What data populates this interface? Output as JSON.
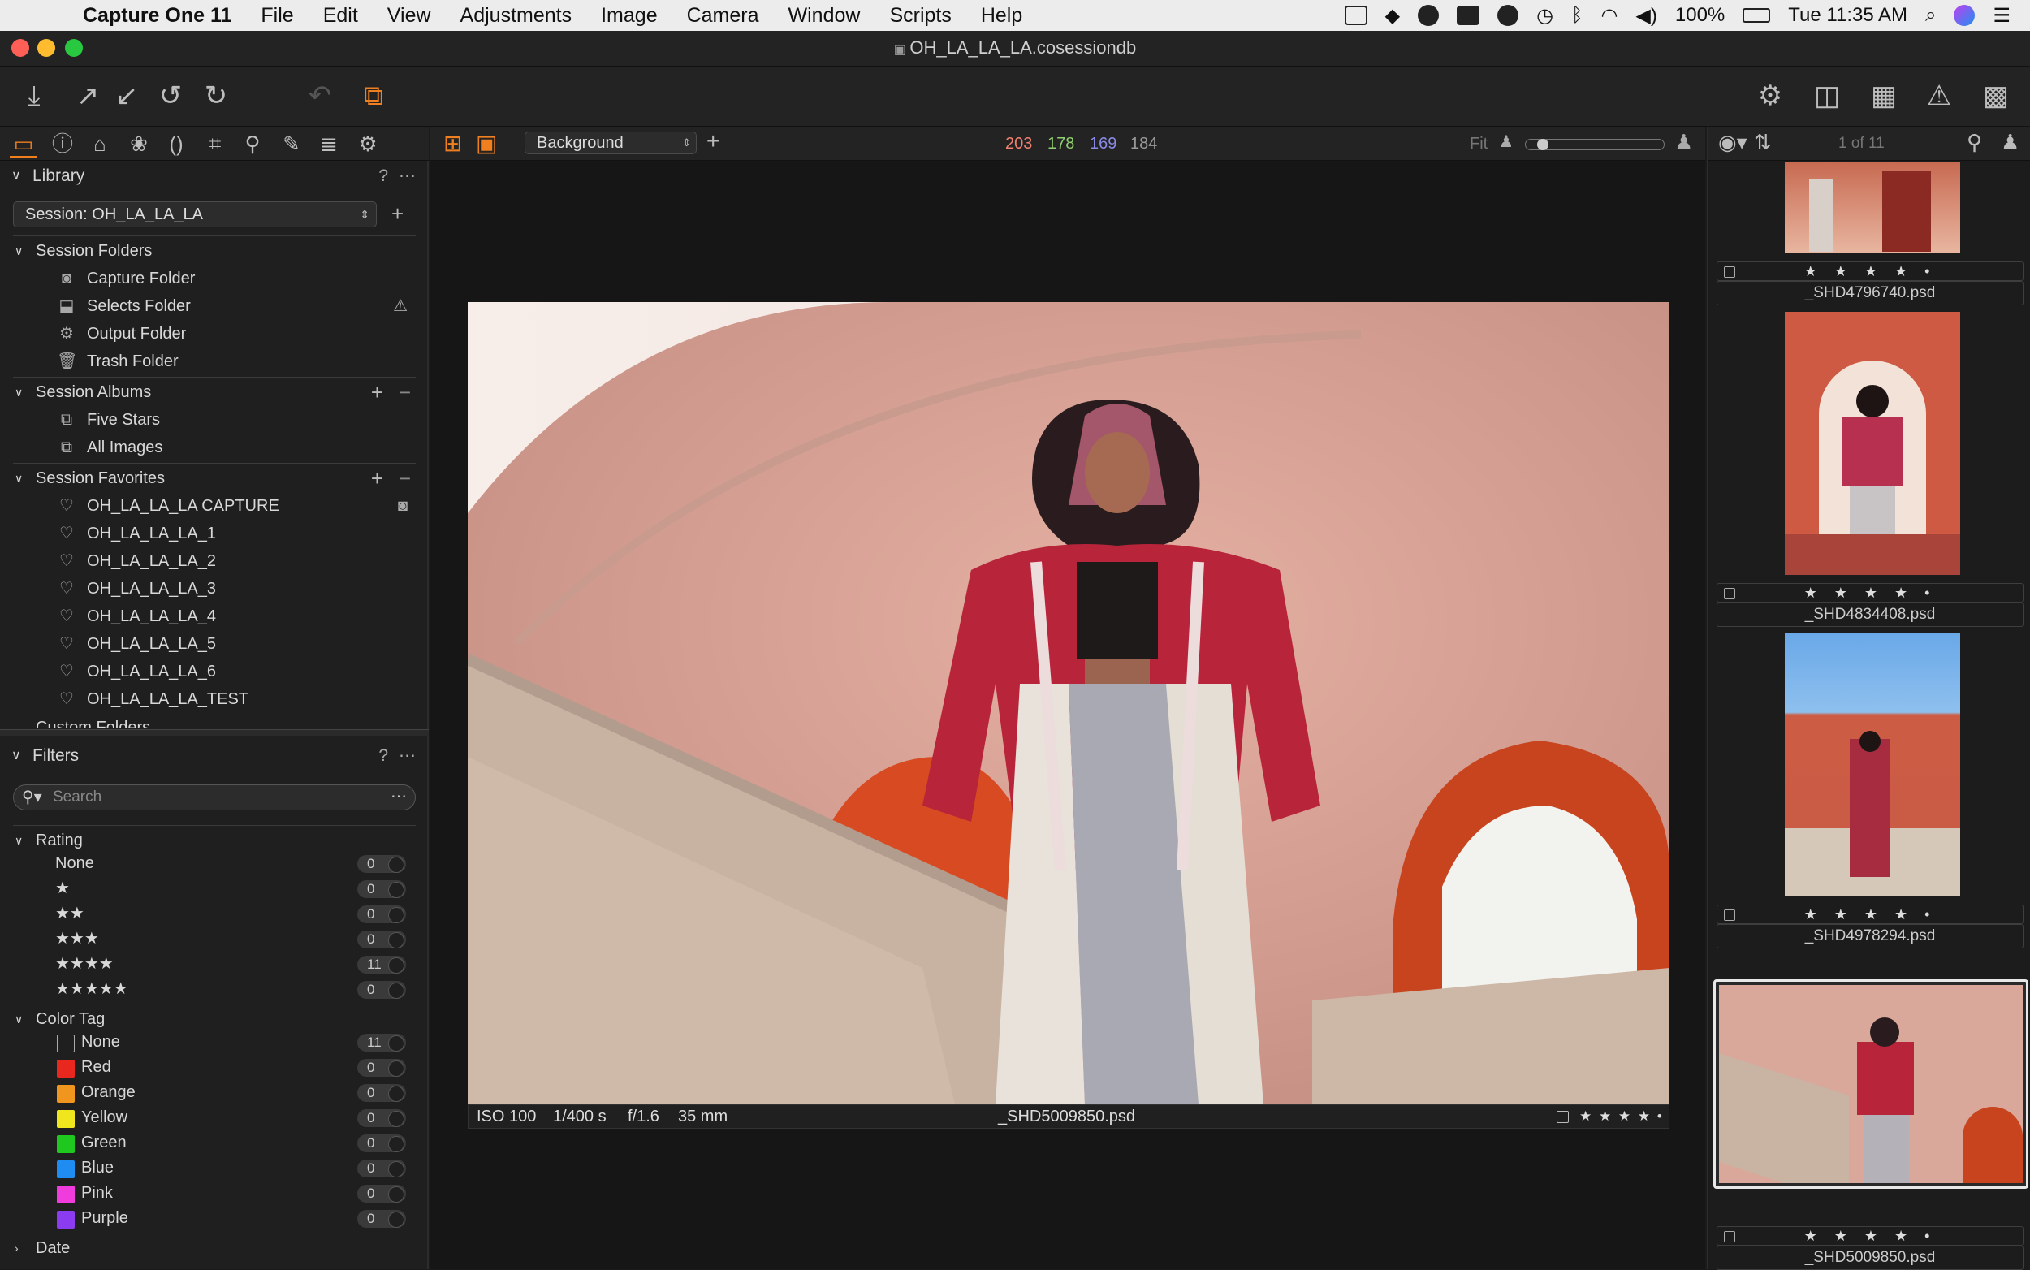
{
  "menubar": {
    "app": "Capture One 11",
    "items": [
      "File",
      "Edit",
      "View",
      "Adjustments",
      "Image",
      "Camera",
      "Window",
      "Scripts",
      "Help"
    ],
    "battery": "100%",
    "clock": "Tue 11:35 AM"
  },
  "window": {
    "title": "OH_LA_LA_LA.cosessiondb"
  },
  "viewer_bar": {
    "layer": "Background",
    "readout": {
      "r": "203",
      "g": "178",
      "b": "169",
      "l": "184"
    },
    "fit": "Fit"
  },
  "browser": {
    "counter": "1 of 11"
  },
  "library": {
    "title": "Library",
    "help": "?",
    "session_select": "Session: OH_LA_LA_LA",
    "session_folders": {
      "title": "Session Folders",
      "items": [
        {
          "label": "Capture Folder",
          "icon": "camera-icon"
        },
        {
          "label": "Selects Folder",
          "icon": "import-icon"
        },
        {
          "label": "Output Folder",
          "icon": "gear-icon"
        },
        {
          "label": "Trash Folder",
          "icon": "trash-icon"
        }
      ]
    },
    "session_albums": {
      "title": "Session Albums",
      "items": [
        {
          "label": "Five Stars"
        },
        {
          "label": "All Images"
        }
      ]
    },
    "session_favorites": {
      "title": "Session Favorites",
      "items": [
        "OH_LA_LA_LA CAPTURE",
        "OH_LA_LA_LA_1",
        "OH_LA_LA_LA_2",
        "OH_LA_LA_LA_3",
        "OH_LA_LA_LA_4",
        "OH_LA_LA_LA_5",
        "OH_LA_LA_LA_6",
        "OH_LA_LA_LA_TEST"
      ]
    },
    "custom_folders": "Custom Folders"
  },
  "filters": {
    "title": "Filters",
    "help": "?",
    "search_placeholder": "Search",
    "rating": {
      "title": "Rating",
      "rows": [
        {
          "label": "None",
          "count": "0"
        },
        {
          "label": "★",
          "count": "0"
        },
        {
          "label": "★★",
          "count": "0"
        },
        {
          "label": "★★★",
          "count": "0"
        },
        {
          "label": "★★★★",
          "count": "11"
        },
        {
          "label": "★★★★★",
          "count": "0"
        }
      ]
    },
    "color_tag": {
      "title": "Color Tag",
      "rows": [
        {
          "label": "None",
          "count": "11",
          "color": "#1f1f1f"
        },
        {
          "label": "Red",
          "count": "0",
          "color": "#e8281e"
        },
        {
          "label": "Orange",
          "count": "0",
          "color": "#f0961e"
        },
        {
          "label": "Yellow",
          "count": "0",
          "color": "#f0e61e"
        },
        {
          "label": "Green",
          "count": "0",
          "color": "#1ec81e"
        },
        {
          "label": "Blue",
          "count": "0",
          "color": "#1e8cf0"
        },
        {
          "label": "Pink",
          "count": "0",
          "color": "#f03cdc"
        },
        {
          "label": "Purple",
          "count": "0",
          "color": "#8c3cf0"
        }
      ]
    },
    "date": "Date"
  },
  "image_info": {
    "iso": "ISO 100",
    "shutter": "1/400 s",
    "aperture": "f/1.6",
    "focal": "35 mm",
    "filename": "_SHD5009850.psd",
    "stars": "★ ★ ★ ★ •"
  },
  "thumbnails": [
    {
      "name": "_SHD4796740.psd",
      "stars": "★ ★ ★ ★ •"
    },
    {
      "name": "_SHD4834408.psd",
      "stars": "★ ★ ★ ★ •"
    },
    {
      "name": "_SHD4978294.psd",
      "stars": "★ ★ ★ ★ •"
    },
    {
      "name": "_SHD5009850.psd",
      "stars": "★ ★ ★ ★ •"
    }
  ]
}
